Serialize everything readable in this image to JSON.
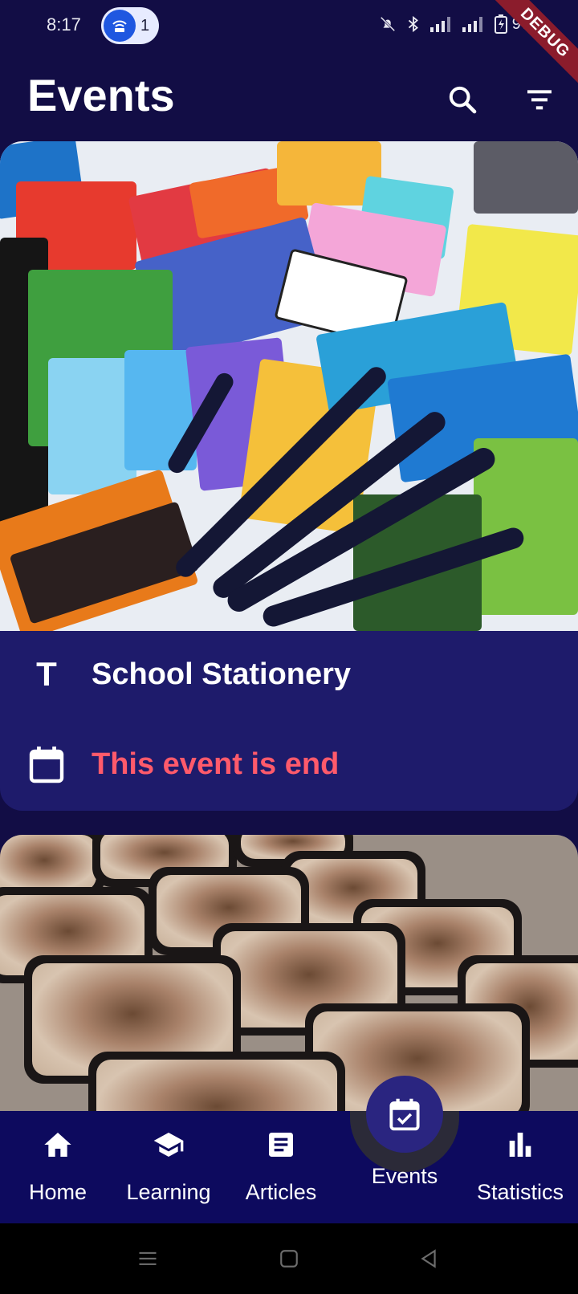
{
  "status_bar": {
    "time": "8:17",
    "hotspot_count": "1",
    "battery": "97",
    "debug_banner": "DEBUG"
  },
  "header": {
    "title": "Events",
    "search_icon": "search-icon",
    "filter_icon": "filter-icon"
  },
  "events": [
    {
      "title": "School Stationery",
      "status": "This event is end",
      "image": "school stationery photo"
    },
    {
      "image": "food trays photo"
    }
  ],
  "bottom_nav": {
    "items": [
      {
        "label": "Home",
        "icon": "home-icon"
      },
      {
        "label": "Learning",
        "icon": "school-icon"
      },
      {
        "label": "Articles",
        "icon": "article-icon"
      },
      {
        "label": "Events",
        "icon": "event-available-icon",
        "active": true
      },
      {
        "label": "Statistics",
        "icon": "bar-chart-icon"
      }
    ]
  },
  "colors": {
    "background": "#120d45",
    "card": "#1e1b6b",
    "nav": "#0d0a5e",
    "status_end": "#ff5a6b"
  }
}
